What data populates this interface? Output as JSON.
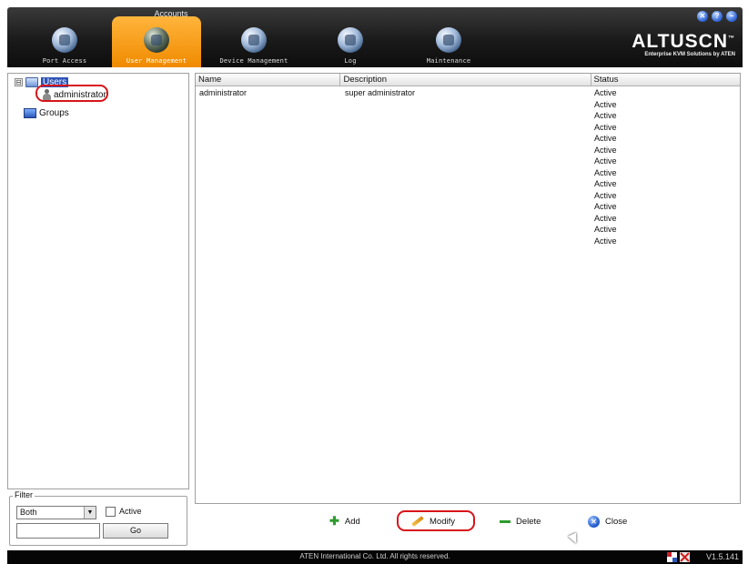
{
  "header": {
    "section_title": "Accounts",
    "tabs": [
      {
        "label": "Port Access",
        "icon": "port-access-icon",
        "active": false
      },
      {
        "label": "User Management",
        "icon": "user-management-icon",
        "active": true
      },
      {
        "label": "Device Management",
        "icon": "device-management-icon",
        "active": false
      },
      {
        "label": "Log",
        "icon": "log-icon",
        "active": false
      },
      {
        "label": "Maintenance",
        "icon": "maintenance-icon",
        "active": false
      }
    ],
    "window_controls": [
      "✕",
      "?",
      "−"
    ],
    "brand": {
      "name": "ALTUSCN",
      "trademark": "™",
      "tagline": "Enterprise KVM Solutions by ATEN"
    },
    "accent_color": "#f39a12"
  },
  "tree": {
    "root_expander": "⊟",
    "users_label": "Users",
    "users_child": "administrator",
    "groups_label": "Groups"
  },
  "filter": {
    "legend": "Filter",
    "select_value": "Both",
    "select_arrow": "▼",
    "active_label": "Active",
    "input_value": "",
    "go_label": "Go"
  },
  "table": {
    "columns": [
      "Name",
      "Description",
      "Status"
    ],
    "rows": [
      {
        "name": "administrator",
        "description": "super administrator",
        "status": "Active"
      },
      {
        "name": "",
        "description": "",
        "status": "Active"
      },
      {
        "name": "",
        "description": "",
        "status": "Active"
      },
      {
        "name": "",
        "description": "",
        "status": "Active"
      },
      {
        "name": "",
        "description": "",
        "status": "Active"
      },
      {
        "name": "",
        "description": "",
        "status": "Active"
      },
      {
        "name": "",
        "description": "",
        "status": "Active"
      },
      {
        "name": "",
        "description": "",
        "status": "Active"
      },
      {
        "name": "",
        "description": "",
        "status": "Active"
      },
      {
        "name": "",
        "description": "",
        "status": "Active"
      },
      {
        "name": "",
        "description": "",
        "status": "Active"
      },
      {
        "name": "",
        "description": "",
        "status": "Active"
      },
      {
        "name": "",
        "description": "",
        "status": "Active"
      },
      {
        "name": "",
        "description": "",
        "status": "Active"
      }
    ]
  },
  "actions": {
    "add": "Add",
    "modify": "Modify",
    "delete": "Delete",
    "close": "Close"
  },
  "statusbar": {
    "copyright": "ATEN International Co. Ltd. All rights reserved.",
    "version": "V1.5.141"
  },
  "highlight_color": "#d7141a"
}
